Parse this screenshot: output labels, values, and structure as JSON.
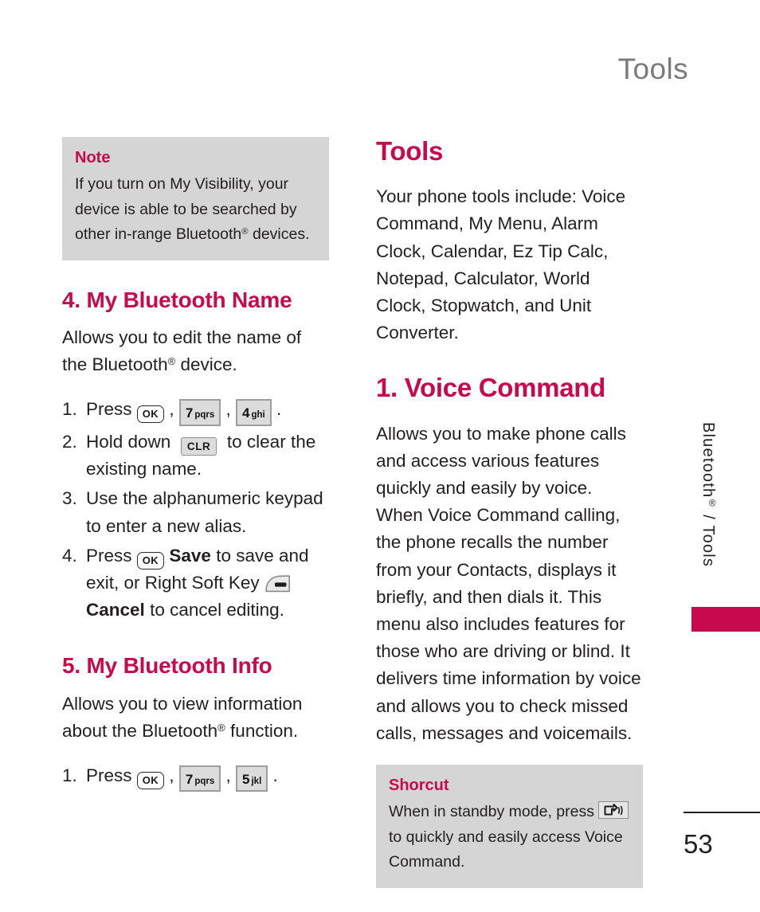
{
  "page": {
    "running_head": "Tools",
    "folio": "53",
    "side_tab_text": "Bluetooth® / Tools",
    "accent_color": "#c8094b",
    "callout_bg": "#d5d5d5",
    "header_color": "#7b7b7b"
  },
  "note_box": {
    "title": "Note",
    "body_before": "If you turn on My Visibility, your device is able to be searched by other in-range Bluetooth",
    "reg": "®",
    "body_after": " devices."
  },
  "left_column": {
    "section_4": {
      "heading": "4. My Bluetooth Name",
      "intro_before": "Allows you to edit the name of the Bluetooth",
      "intro_reg": "®",
      "intro_after": " device.",
      "steps": [
        {
          "num": "1.",
          "text_before": "Press",
          "keys": [
            "ok",
            "7pqrs",
            "4ghi"
          ],
          "text_after": "."
        },
        {
          "num": "2.",
          "text_before": "Hold down",
          "keys": [
            "clr"
          ],
          "text_after": "to clear the existing name."
        },
        {
          "num": "3.",
          "text_before": "Use the alphanumeric keypad to enter a new alias.",
          "keys": [],
          "text_after": ""
        },
        {
          "num": "4.",
          "text_before": "Press",
          "keys": [
            "ok"
          ],
          "bold_1": "Save",
          "mid": "to save and exit, or Right Soft Key",
          "keys_2": [
            "softkey"
          ],
          "bold_2": "Cancel",
          "text_after": "to cancel editing."
        }
      ]
    },
    "section_5": {
      "heading": "5. My Bluetooth Info",
      "intro_before": "Allows you to view information about the Bluetooth",
      "intro_reg": "®",
      "intro_after": " function.",
      "steps": [
        {
          "num": "1.",
          "text_before": "Press",
          "keys": [
            "ok",
            "7pqrs",
            "5jkl"
          ],
          "text_after": "."
        }
      ]
    }
  },
  "right_column": {
    "tools_heading": "Tools",
    "tools_body": "Your phone tools include: Voice Command, My Menu, Alarm Clock, Calendar, Ez Tip Calc, Notepad, Calculator, World Clock, Stopwatch, and Unit Converter.",
    "voice_heading": "1. Voice Command",
    "voice_body": "Allows you to make phone calls and access various features quickly and easily by voice. When Voice Command calling, the phone recalls the number from your Contacts, displays it briefly, and then dials it. This menu also includes features for those who are driving or blind. It delivers time information by voice and allows you to check missed calls, messages and voicemails.",
    "shortcut_box": {
      "title": "Shorcut",
      "body_before": "When in standby mode, press",
      "key": "voice-key",
      "body_after": "to quickly and easily access Voice Command."
    }
  },
  "keys": {
    "ok": "OK",
    "clr": "CLR",
    "7pqrs_digit": "7",
    "7pqrs_letters": "pqrs",
    "4ghi_digit": "4",
    "4ghi_letters": "ghi",
    "5jkl_digit": "5",
    "5jkl_letters": "jkl"
  }
}
